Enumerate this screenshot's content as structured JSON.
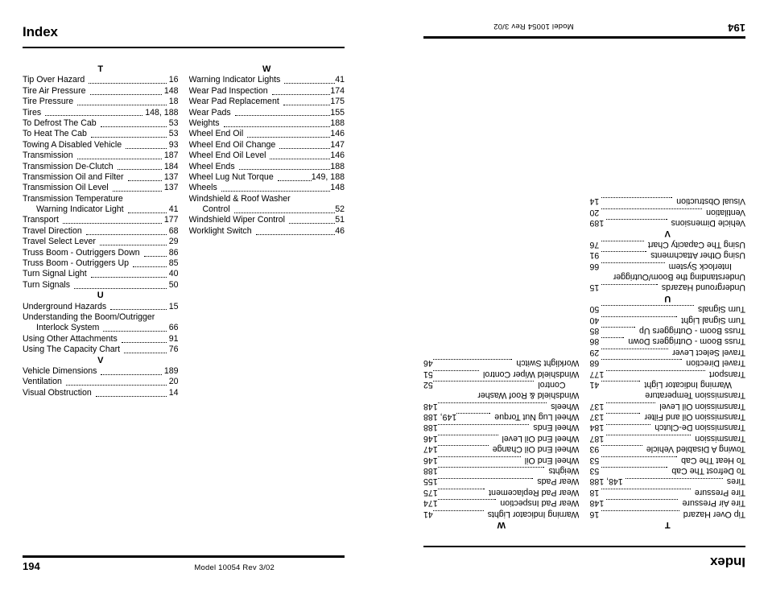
{
  "document": {
    "title": "Index",
    "page_number": "194",
    "footer_model": "Model  10054    Rev  3/02",
    "ink_color": "#000000",
    "paper_color": "#ffffff"
  },
  "columns": [
    {
      "id": "column-left",
      "sections": [
        {
          "letter": "T",
          "entries": [
            {
              "label": "Tip Over Hazard",
              "page": "16",
              "indented": false,
              "leader": true
            },
            {
              "label": "Tire Air Pressure",
              "page": "148",
              "indented": false,
              "leader": true
            },
            {
              "label": "Tire Pressure",
              "page": "18",
              "indented": false,
              "leader": true
            },
            {
              "label": "Tires",
              "page": "148, 188",
              "indented": false,
              "leader": true
            },
            {
              "label": "To Defrost The Cab",
              "page": "53",
              "indented": false,
              "leader": true
            },
            {
              "label": "To Heat The Cab",
              "page": "53",
              "indented": false,
              "leader": true
            },
            {
              "label": "Towing A Disabled Vehicle",
              "page": "93",
              "indented": false,
              "leader": true
            },
            {
              "label": "Transmission",
              "page": "187",
              "indented": false,
              "leader": true
            },
            {
              "label": "Transmission De-Clutch",
              "page": "184",
              "indented": false,
              "leader": true
            },
            {
              "label": "Transmission Oil and Filter",
              "page": "137",
              "indented": false,
              "leader": true
            },
            {
              "label": "Transmission Oil Level",
              "page": "137",
              "indented": false,
              "leader": true
            },
            {
              "label": "Transmission Temperature",
              "page": "",
              "indented": false,
              "leader": false
            },
            {
              "label": "Warning Indicator Light",
              "page": "41",
              "indented": true,
              "leader": true
            },
            {
              "label": "Transport",
              "page": "177",
              "indented": false,
              "leader": true
            },
            {
              "label": "Travel Direction",
              "page": "68",
              "indented": false,
              "leader": true
            },
            {
              "label": "Travel Select Lever",
              "page": "29",
              "indented": false,
              "leader": true
            },
            {
              "label": "Truss Boom - Outriggers Down",
              "page": "86",
              "indented": false,
              "leader": true
            },
            {
              "label": "Truss Boom - Outriggers Up",
              "page": "85",
              "indented": false,
              "leader": true
            },
            {
              "label": "Turn Signal Light",
              "page": "40",
              "indented": false,
              "leader": true
            },
            {
              "label": "Turn Signals",
              "page": "50",
              "indented": false,
              "leader": true
            }
          ]
        },
        {
          "letter": "U",
          "entries": [
            {
              "label": "Underground Hazards",
              "page": "15",
              "indented": false,
              "leader": true
            },
            {
              "label": "Understanding the Boom/Outrigger",
              "page": "",
              "indented": false,
              "leader": false
            },
            {
              "label": "Interlock System",
              "page": "66",
              "indented": true,
              "leader": true
            },
            {
              "label": "Using Other Attachments",
              "page": "91",
              "indented": false,
              "leader": true
            },
            {
              "label": "Using The Capacity Chart",
              "page": "76",
              "indented": false,
              "leader": true
            }
          ]
        },
        {
          "letter": "V",
          "entries": [
            {
              "label": "Vehicle Dimensions",
              "page": "189",
              "indented": false,
              "leader": true
            },
            {
              "label": "Ventilation",
              "page": "20",
              "indented": false,
              "leader": true
            },
            {
              "label": "Visual Obstruction",
              "page": "14",
              "indented": false,
              "leader": true
            }
          ]
        }
      ]
    },
    {
      "id": "column-right",
      "sections": [
        {
          "letter": "W",
          "entries": [
            {
              "label": "Warning Indicator Lights",
              "page": "41",
              "indented": false,
              "leader": true
            },
            {
              "label": "Wear Pad Inspection",
              "page": "174",
              "indented": false,
              "leader": true
            },
            {
              "label": "Wear Pad Replacement",
              "page": "175",
              "indented": false,
              "leader": true
            },
            {
              "label": "Wear Pads",
              "page": "155",
              "indented": false,
              "leader": true
            },
            {
              "label": "Weights",
              "page": "188",
              "indented": false,
              "leader": true
            },
            {
              "label": "Wheel End Oil",
              "page": "146",
              "indented": false,
              "leader": true
            },
            {
              "label": "Wheel End Oil Change",
              "page": "147",
              "indented": false,
              "leader": true
            },
            {
              "label": "Wheel End Oil Level",
              "page": "146",
              "indented": false,
              "leader": true
            },
            {
              "label": "Wheel Ends",
              "page": "188",
              "indented": false,
              "leader": true
            },
            {
              "label": "Wheel Lug Nut Torque",
              "page": "149, 188",
              "indented": false,
              "leader": true
            },
            {
              "label": "Wheels",
              "page": "148",
              "indented": false,
              "leader": true
            },
            {
              "label": "Windshield & Roof Washer",
              "page": "",
              "indented": false,
              "leader": false
            },
            {
              "label": "Control",
              "page": "52",
              "indented": true,
              "leader": true
            },
            {
              "label": "Windshield Wiper Control",
              "page": "51",
              "indented": false,
              "leader": true
            },
            {
              "label": "Worklight Switch",
              "page": "46",
              "indented": false,
              "leader": true
            }
          ]
        }
      ]
    }
  ]
}
